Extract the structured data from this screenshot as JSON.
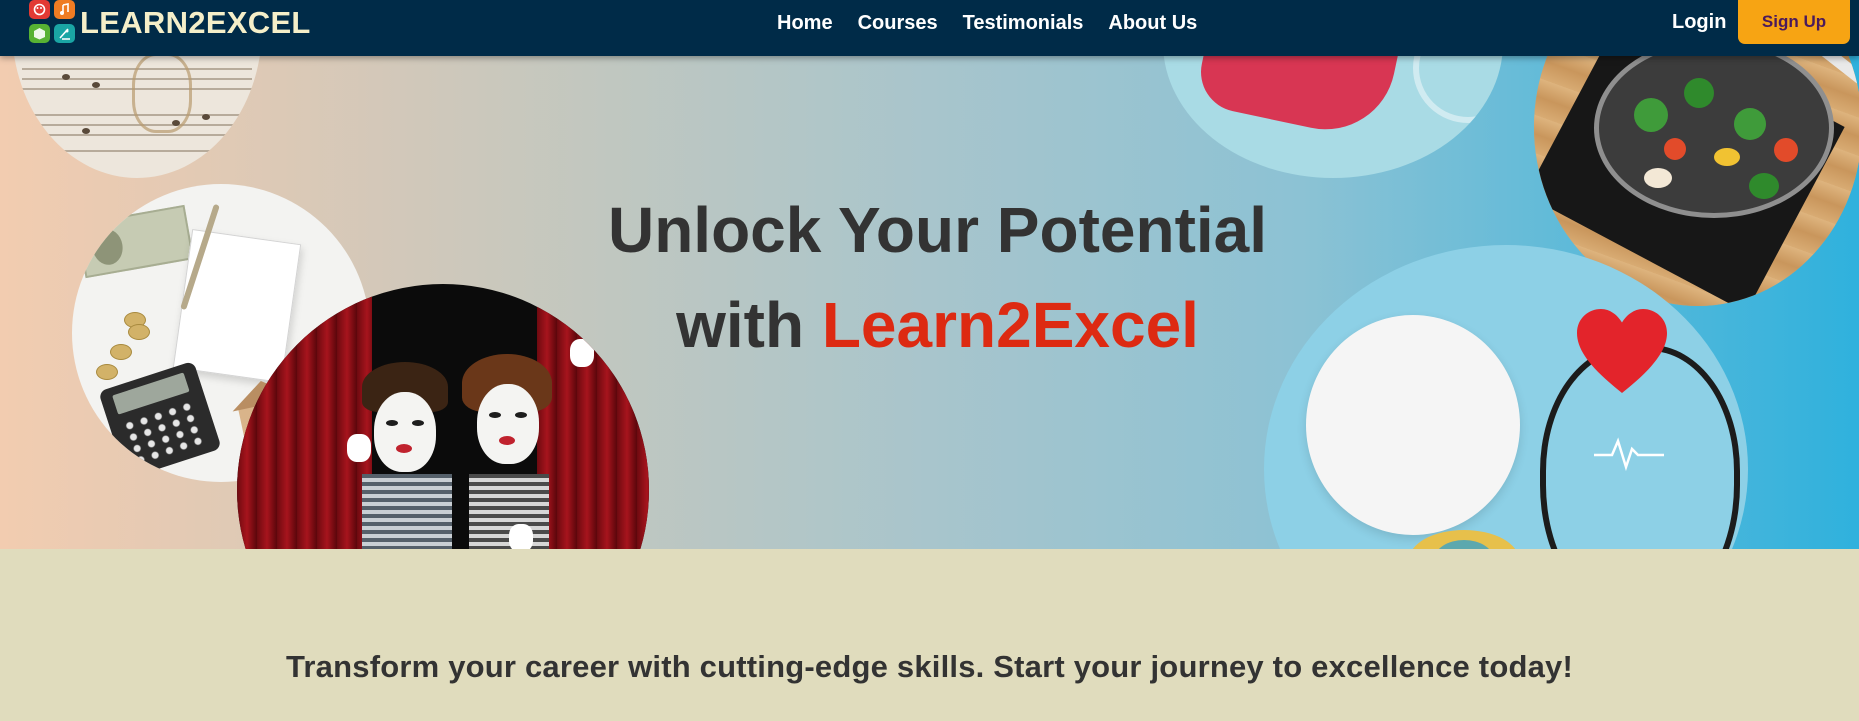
{
  "navbar": {
    "logo_text": "LEARN2EXCEL",
    "links": [
      {
        "label": "Home"
      },
      {
        "label": "Courses"
      },
      {
        "label": "Testimonials"
      },
      {
        "label": "About Us"
      }
    ],
    "login_label": "Login",
    "signup_label": "Sign Up"
  },
  "hero": {
    "title_line1": "Unlock Your Potential",
    "title_with": "with",
    "title_brand": "Learn2Excel"
  },
  "tagline": "Transform your career with cutting-edge skills. Start your journey to excellence today!",
  "colors": {
    "navbar_bg": "#002b48",
    "signup_bg": "#f7a413",
    "accent_red": "#dd2a12",
    "section_bg": "#e0dcbd"
  },
  "icons": [
    "logo-palette-icon",
    "logo-music-icon",
    "logo-cube-icon",
    "logo-science-icon"
  ]
}
